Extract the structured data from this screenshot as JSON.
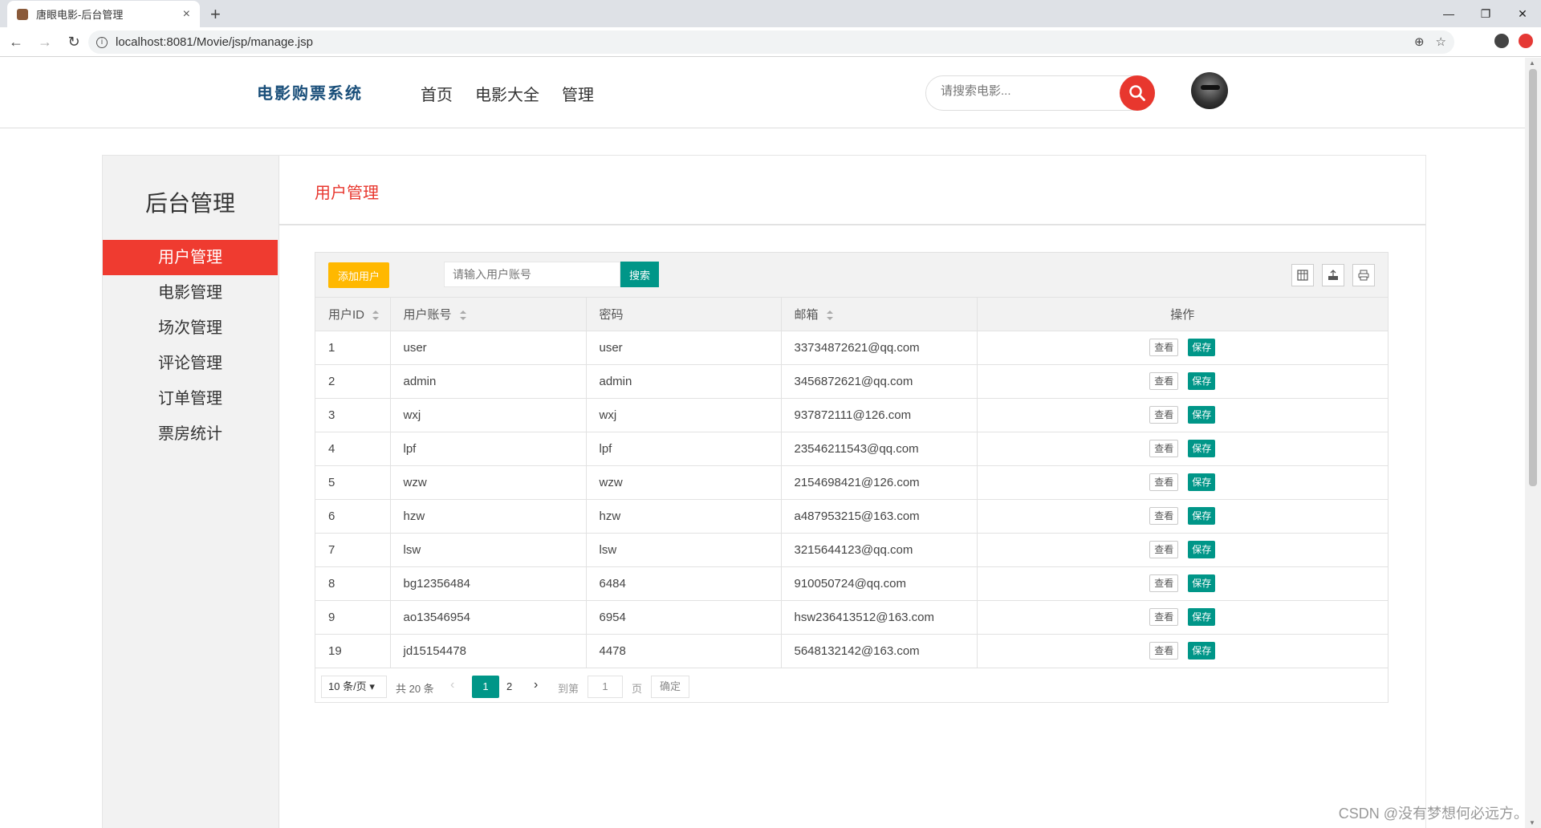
{
  "browser": {
    "tab_title": "唐眼电影-后台管理",
    "url": "localhost:8081/Movie/jsp/manage.jsp"
  },
  "header": {
    "logo": "电影购票系统",
    "nav": [
      "首页",
      "电影大全",
      "管理"
    ],
    "search_placeholder": "请搜索电影..."
  },
  "sidebar": {
    "title": "后台管理",
    "items": [
      "用户管理",
      "电影管理",
      "场次管理",
      "评论管理",
      "订单管理",
      "票房统计"
    ],
    "active": "用户管理"
  },
  "content": {
    "title": "用户管理",
    "add_button": "添加用户",
    "search_placeholder": "请输入用户账号",
    "search_button": "搜索"
  },
  "table": {
    "columns": [
      "用户ID",
      "用户账号",
      "密码",
      "邮箱",
      "操作"
    ],
    "view_label": "查看",
    "save_label": "保存",
    "rows": [
      {
        "id": "1",
        "account": "user",
        "password": "user",
        "email": "33734872621@qq.com"
      },
      {
        "id": "2",
        "account": "admin",
        "password": "admin",
        "email": "3456872621@qq.com"
      },
      {
        "id": "3",
        "account": "wxj",
        "password": "wxj",
        "email": "937872111@126.com"
      },
      {
        "id": "4",
        "account": "lpf",
        "password": "lpf",
        "email": "23546211543@qq.com"
      },
      {
        "id": "5",
        "account": "wzw",
        "password": "wzw",
        "email": "2154698421@126.com"
      },
      {
        "id": "6",
        "account": "hzw",
        "password": "hzw",
        "email": "a487953215@163.com"
      },
      {
        "id": "7",
        "account": "lsw",
        "password": "lsw",
        "email": "3215644123@qq.com"
      },
      {
        "id": "8",
        "account": "bg12356484",
        "password": "6484",
        "email": "910050724@qq.com"
      },
      {
        "id": "9",
        "account": "ao13546954",
        "password": "6954",
        "email": "hsw236413512@163.com"
      },
      {
        "id": "19",
        "account": "jd15154478",
        "password": "4478",
        "email": "5648132142@163.com"
      }
    ]
  },
  "pager": {
    "per_page": "10 条/页",
    "total": "共 20 条",
    "current": "1",
    "page2": "2",
    "goto_label": "到第",
    "goto_value": "1",
    "page_label": "页",
    "confirm": "确定"
  },
  "watermark": "CSDN @没有梦想何必远方。"
}
